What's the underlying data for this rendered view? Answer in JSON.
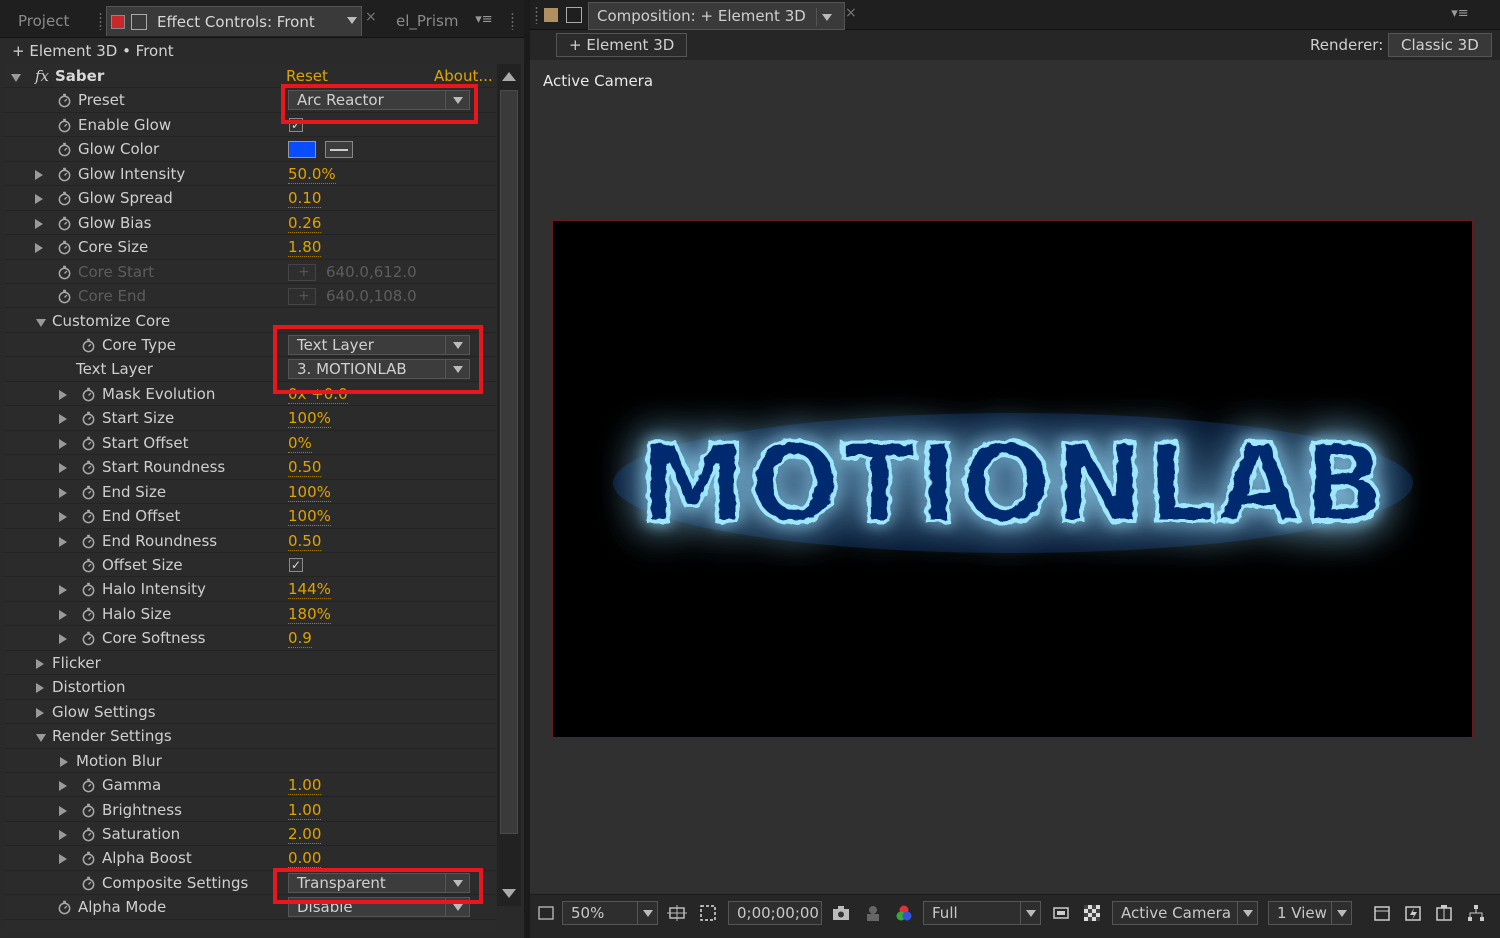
{
  "left_panel": {
    "tabs": {
      "project": "Project",
      "effect_controls": "Effect Controls: Front",
      "prism": "el_Prism"
    },
    "breadcrumb": "+ Element 3D • Front",
    "effect": {
      "name": "Saber",
      "fx_glyph": "fx",
      "reset": "Reset",
      "about": "About..."
    },
    "properties": {
      "preset": {
        "label": "Preset",
        "value": "Arc Reactor"
      },
      "enable_glow": {
        "label": "Enable Glow",
        "checked": true
      },
      "glow_color": {
        "label": "Glow Color",
        "color": "#0a4cff"
      },
      "glow_intensity": {
        "label": "Glow Intensity",
        "value": "50.0%"
      },
      "glow_spread": {
        "label": "Glow Spread",
        "value": "0.10"
      },
      "glow_bias": {
        "label": "Glow Bias",
        "value": "0.26"
      },
      "core_size": {
        "label": "Core Size",
        "value": "1.80"
      },
      "core_start": {
        "label": "Core Start",
        "value": "640.0,612.0"
      },
      "core_end": {
        "label": "Core End",
        "value": "640.0,108.0"
      },
      "customize_core": {
        "label": "Customize Core"
      },
      "core_type": {
        "label": "Core Type",
        "value": "Text Layer"
      },
      "text_layer": {
        "label": "Text Layer",
        "value": "3. MOTIONLAB"
      },
      "mask_evolution": {
        "label": "Mask Evolution",
        "value": "0x +0.0"
      },
      "start_size": {
        "label": "Start Size",
        "value": "100%"
      },
      "start_offset": {
        "label": "Start Offset",
        "value": "0%"
      },
      "start_roundness": {
        "label": "Start Roundness",
        "value": "0.50"
      },
      "end_size": {
        "label": "End Size",
        "value": "100%"
      },
      "end_offset": {
        "label": "End Offset",
        "value": "100%"
      },
      "end_roundness": {
        "label": "End Roundness",
        "value": "0.50"
      },
      "offset_size": {
        "label": "Offset Size",
        "checked": true
      },
      "halo_intensity": {
        "label": "Halo Intensity",
        "value": "144%"
      },
      "halo_size": {
        "label": "Halo Size",
        "value": "180%"
      },
      "core_softness": {
        "label": "Core Softness",
        "value": "0.9"
      },
      "flicker": {
        "label": "Flicker"
      },
      "distortion": {
        "label": "Distortion"
      },
      "glow_settings": {
        "label": "Glow Settings"
      },
      "render_settings": {
        "label": "Render Settings"
      },
      "motion_blur": {
        "label": "Motion Blur"
      },
      "gamma": {
        "label": "Gamma",
        "value": "1.00"
      },
      "brightness": {
        "label": "Brightness",
        "value": "1.00"
      },
      "saturation": {
        "label": "Saturation",
        "value": "2.00"
      },
      "alpha_boost": {
        "label": "Alpha Boost",
        "value": "0.00"
      },
      "composite_settings": {
        "label": "Composite Settings",
        "value": "Transparent"
      },
      "alpha_mode": {
        "label": "Alpha Mode",
        "value": "Disable"
      }
    },
    "highlight_color": "#e8171e",
    "value_color": "#e0a300"
  },
  "right_panel": {
    "tab": "Composition: + Element 3D",
    "element_button": "+ Element 3D",
    "renderer_label": "Renderer:",
    "renderer_value": "Classic 3D",
    "viewer_label": "Active Camera",
    "canvas_text": "MOTIONLAB",
    "glow_color": "#1e90ff",
    "footer": {
      "zoom": "50%",
      "timecode": "0;00;00;00",
      "resolution": "Full",
      "camera": "Active Camera",
      "views": "1 View"
    }
  }
}
